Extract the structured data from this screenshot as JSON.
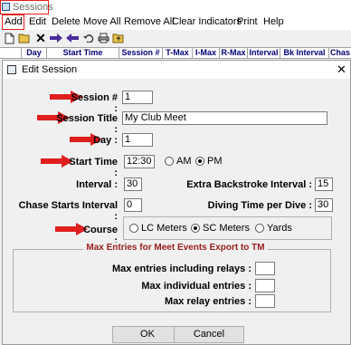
{
  "window": {
    "title": "Sessions"
  },
  "menu": {
    "items": [
      "Add",
      "Edit",
      "Delete",
      "Move All",
      "Remove All",
      "Clear Indicators",
      "Print",
      "Help"
    ]
  },
  "grid": {
    "columns": [
      "Day",
      "Start Time",
      "Session #",
      "T-Max",
      "I-Max",
      "R-Max",
      "Interval",
      "Bk Interval",
      "Chas"
    ]
  },
  "dialog": {
    "title": "Edit Session",
    "session_number": {
      "label": "Session # :",
      "value": "1"
    },
    "session_title": {
      "label": "Session Title :",
      "value": "My Club Meet"
    },
    "day": {
      "label": "Day :",
      "value": "1"
    },
    "start_time": {
      "label": "Start Time :",
      "value": "12:30",
      "am_label": "AM",
      "pm_label": "PM",
      "selected": "PM"
    },
    "interval": {
      "label": "Interval :",
      "value": "30"
    },
    "backstroke_interval": {
      "label": "Extra Backstroke Interval :",
      "value": "15"
    },
    "chase_interval": {
      "label": "Chase Starts Interval :",
      "value": "0"
    },
    "diving_time": {
      "label": "Diving Time per Dive :",
      "value": "30"
    },
    "course": {
      "label": "Course :",
      "options": [
        "LC Meters",
        "SC Meters",
        "Yards"
      ],
      "selected": "SC Meters"
    },
    "max_entries": {
      "title": "Max Entries for Meet Events Export to TM",
      "including_relays_label": "Max entries including relays :",
      "individual_label": "Max individual entries :",
      "relay_label": "Max relay entries :",
      "including_relays_value": "",
      "individual_value": "",
      "relay_value": ""
    },
    "ok_label": "OK",
    "cancel_label": "Cancel"
  },
  "colors": {
    "annotation_red": "#e01e1e",
    "header_text": "#00007a",
    "group_title": "#9b2020"
  }
}
